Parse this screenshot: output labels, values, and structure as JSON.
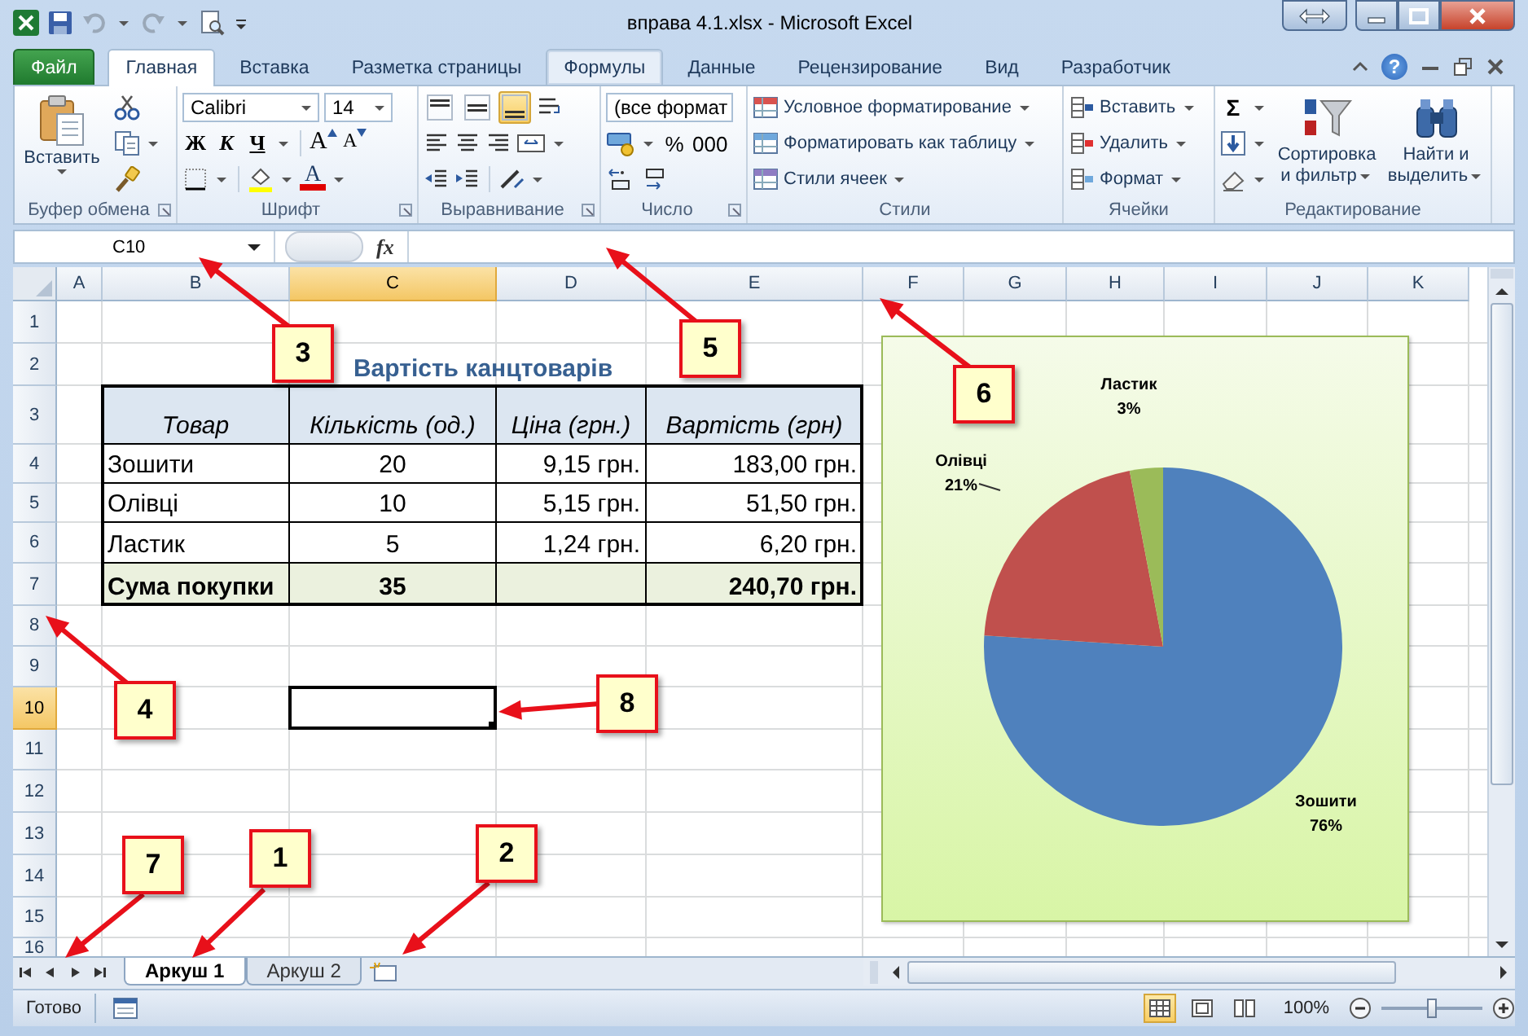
{
  "title_bar": {
    "title": "вправа 4.1.xlsx - Microsoft Excel"
  },
  "ribbon_tabs": [
    {
      "label": "Файл",
      "kind": "file",
      "selected": false,
      "hovered": false
    },
    {
      "label": "Главная",
      "kind": "tab",
      "selected": true,
      "hovered": false
    },
    {
      "label": "Вставка",
      "kind": "tab",
      "selected": false,
      "hovered": false
    },
    {
      "label": "Разметка страницы",
      "kind": "tab",
      "selected": false,
      "hovered": false
    },
    {
      "label": "Формулы",
      "kind": "tab",
      "selected": false,
      "hovered": true
    },
    {
      "label": "Данные",
      "kind": "tab",
      "selected": false,
      "hovered": false
    },
    {
      "label": "Рецензирование",
      "kind": "tab",
      "selected": false,
      "hovered": false
    },
    {
      "label": "Вид",
      "kind": "tab",
      "selected": false,
      "hovered": false
    },
    {
      "label": "Разработчик",
      "kind": "tab",
      "selected": false,
      "hovered": false
    }
  ],
  "help": "?",
  "clipboard": {
    "label": "Буфер обмена",
    "paste": "Вставить"
  },
  "font": {
    "label": "Шрифт",
    "name": "Calibri",
    "size": "14",
    "bold": "Ж",
    "italic": "К",
    "underline": "Ч",
    "grow": "A",
    "shrink": "A",
    "color_label": "A"
  },
  "alignment": {
    "label": "Выравнивание",
    "vertical": [
      {
        "kind": "top",
        "selected": false
      },
      {
        "kind": "middle",
        "selected": false
      },
      {
        "kind": "bottom",
        "selected": true
      }
    ]
  },
  "number": {
    "label": "Число",
    "format": "(все формат",
    "percent": "%",
    "thousands": "000"
  },
  "styles": {
    "label": "Стили",
    "items": [
      "Условное форматирование",
      "Форматировать как таблицу",
      "Стили ячеек"
    ]
  },
  "cells": {
    "label": "Ячейки",
    "items": [
      "Вставить",
      "Удалить",
      "Формат"
    ]
  },
  "editing": {
    "label": "Редактирование",
    "sum": "Σ",
    "sort": "Сортировка и фильтр",
    "find": "Найти и выделить"
  },
  "formula_bar": {
    "name_box": "C10",
    "function_label": "fx"
  },
  "sheet": {
    "columns": [
      {
        "label": "A",
        "selected": false
      },
      {
        "label": "B",
        "selected": false
      },
      {
        "label": "C",
        "selected": true
      },
      {
        "label": "D",
        "selected": false
      },
      {
        "label": "E",
        "selected": false
      },
      {
        "label": "F",
        "selected": false
      },
      {
        "label": "G",
        "selected": false
      },
      {
        "label": "H",
        "selected": false
      },
      {
        "label": "I",
        "selected": false
      },
      {
        "label": "J",
        "selected": false
      },
      {
        "label": "K",
        "selected": false
      }
    ],
    "rows": [
      {
        "label": "1",
        "selected": false
      },
      {
        "label": "2",
        "selected": false
      },
      {
        "label": "3",
        "selected": false
      },
      {
        "label": "4",
        "selected": false
      },
      {
        "label": "5",
        "selected": false
      },
      {
        "label": "6",
        "selected": false
      },
      {
        "label": "7",
        "selected": false
      },
      {
        "label": "8",
        "selected": false
      },
      {
        "label": "9",
        "selected": false
      },
      {
        "label": "10",
        "selected": true
      },
      {
        "label": "11",
        "selected": false
      },
      {
        "label": "12",
        "selected": false
      },
      {
        "label": "13",
        "selected": false
      },
      {
        "label": "14",
        "selected": false
      },
      {
        "label": "15",
        "selected": false
      },
      {
        "label": "16",
        "selected": false
      }
    ]
  },
  "table": {
    "title": "Вартість канцтоварів",
    "columns": [
      "Товар",
      "Кількість (од.)",
      "Ціна (грн.)",
      "Вартість (грн)"
    ],
    "rows": [
      [
        "Зошити",
        "20",
        "9,15 грн.",
        "183,00 грн."
      ],
      [
        "Олівці",
        "10",
        "5,15 грн.",
        "51,50 грн."
      ],
      [
        "Ластик",
        "5",
        "1,24 грн.",
        "6,20 грн."
      ]
    ],
    "total": {
      "label": "Сума покупки",
      "quantity": "35",
      "cost": "240,70 грн."
    }
  },
  "chart": {
    "chart_data": {
      "type": "pie",
      "categories": [
        "Зошити",
        "Олівці",
        "Ластик"
      ],
      "values": [
        76,
        21,
        3
      ],
      "value_labels": [
        "76%",
        "21%",
        "3%"
      ]
    }
  },
  "sheet_tabs": [
    {
      "label": "Аркуш 1",
      "selected": true
    },
    {
      "label": "Аркуш 2",
      "selected": false
    }
  ],
  "status_bar": {
    "status": "Готово",
    "zoom": "100%",
    "zoom_slider": {
      "level": 0.5
    },
    "views": [
      {
        "kind": "normal",
        "selected": true
      },
      {
        "kind": "layout",
        "selected": false
      },
      {
        "kind": "break",
        "selected": false
      }
    ]
  },
  "callouts": [
    {
      "label": "3"
    },
    {
      "label": "5"
    },
    {
      "label": "6"
    },
    {
      "label": "4"
    },
    {
      "label": "8"
    },
    {
      "label": "7"
    },
    {
      "label": "1"
    },
    {
      "label": "2"
    }
  ]
}
